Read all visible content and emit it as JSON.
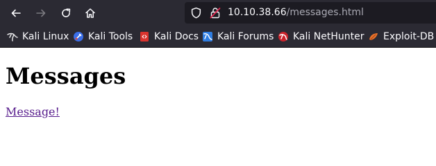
{
  "toolbar": {
    "back_icon": "arrow-left-icon",
    "forward_icon": "arrow-right-icon",
    "reload_icon": "reload-icon",
    "home_icon": "home-icon",
    "url_host": "10.10.38.66",
    "url_path": "/messages.html",
    "colors": {
      "toolbar_bg": "#2b2a33",
      "urlbar_bg": "#1c1b22",
      "url_text": "#fbfbfe",
      "url_path_text": "#a9a9b3"
    }
  },
  "bookmarks": [
    {
      "label": "Kali Linux",
      "icon": "kali-dragon-icon"
    },
    {
      "label": "Kali Tools",
      "icon": "kali-tools-icon"
    },
    {
      "label": "Kali Docs",
      "icon": "kali-docs-icon"
    },
    {
      "label": "Kali Forums",
      "icon": "kali-forums-icon"
    },
    {
      "label": "Kali NetHunter",
      "icon": "kali-nethunter-icon"
    },
    {
      "label": "Exploit-DB",
      "icon": "exploit-db-icon"
    }
  ],
  "page": {
    "heading": "Messages",
    "link_text": "Message!",
    "link_color": "#551a8b"
  }
}
